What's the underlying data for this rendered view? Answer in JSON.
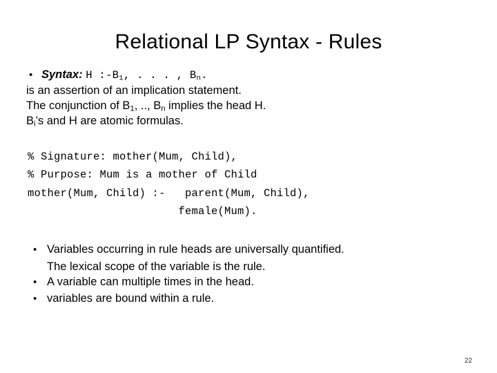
{
  "slide": {
    "title": "Relational LP Syntax - Rules",
    "page_number": "22",
    "bullets_top": [
      {
        "marker": "•",
        "label": "Syntax:",
        "code": "H :-B",
        "code_sub": "1",
        "code_tail": ",  . . . ,  B",
        "code_tail_sub": "n",
        "code_end": "."
      }
    ],
    "lines_top": [
      "is an assertion of an implication statement.",
      "The conjunction of B",
      " implies the head H.",
      "’s and H are atomic formulas."
    ],
    "line2_sub": "1",
    "line2_mid": ", .., B",
    "line2_sub2": "n",
    "line3_pre": "B",
    "line3_sub": "i",
    "code_block": [
      "% Signature: mother(Mum, Child),",
      "% Purpose: Mum is a mother of Child",
      "mother(Mum, Child) :-   parent(Mum, Child),",
      "                       female(Mum)."
    ],
    "bullets_bottom": [
      {
        "marker": "•",
        "text": "Variables occurring in rule heads are universally quantified.",
        "continuation": "The lexical scope of the variable is the rule."
      },
      {
        "marker": "•",
        "text": "A variable can multiple times in the head.",
        "continuation": ""
      },
      {
        "marker": "•",
        "text": "variables are bound within a rule.",
        "continuation": ""
      }
    ]
  }
}
